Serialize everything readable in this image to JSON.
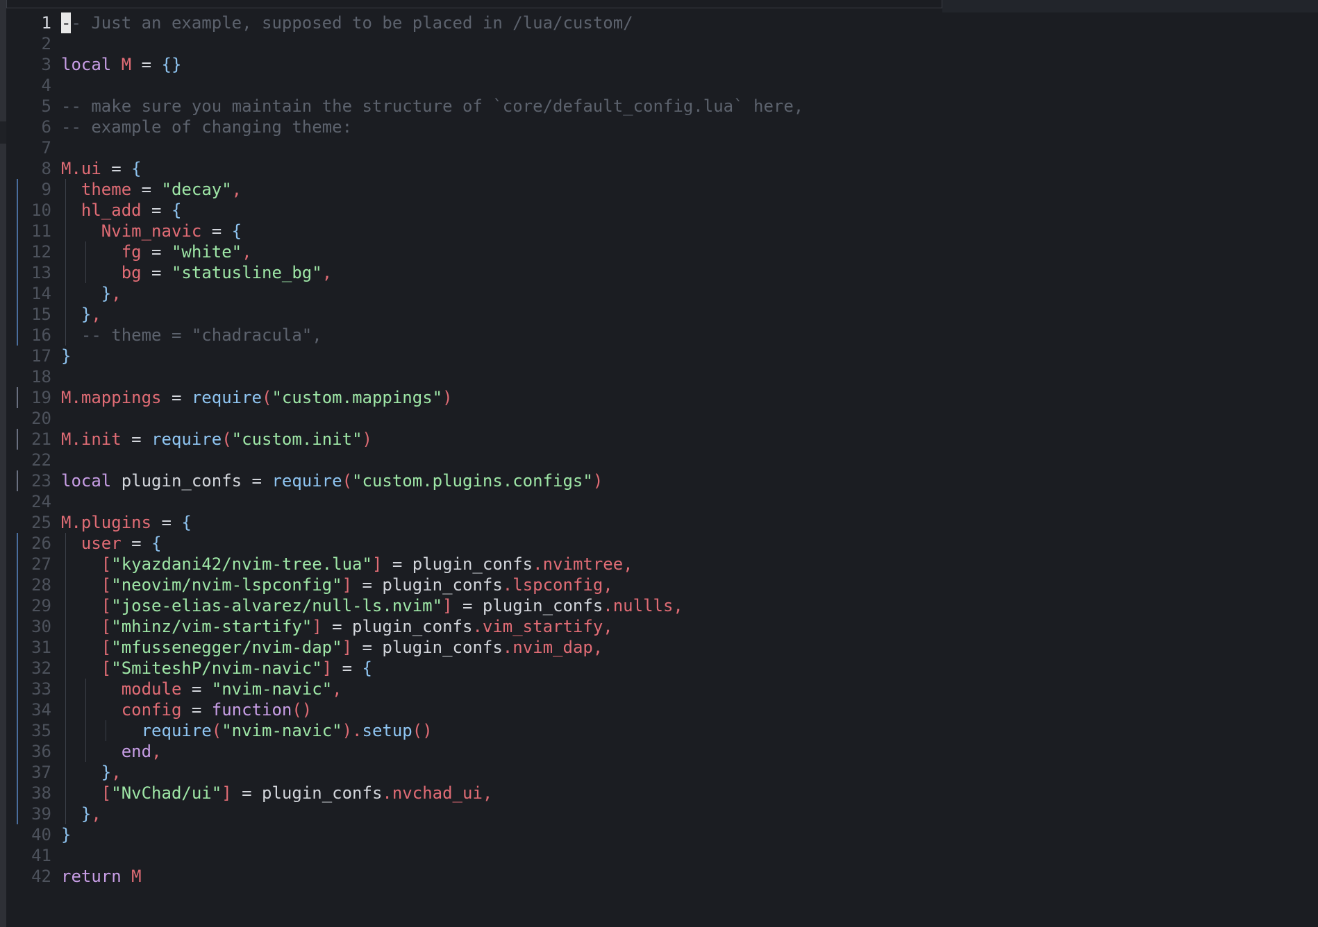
{
  "colors": {
    "background": "#1b1d22",
    "comment": "#5c626d",
    "keyword": "#c89ee6",
    "variable": "#e06c75",
    "string": "#9ee6a6",
    "function": "#8fc5f2",
    "brace": "#8fc5f2",
    "default": "#d3d6dc",
    "line_number": "#4d525c",
    "current_line_number": "#d9dce2"
  },
  "editor": {
    "current_line": 1,
    "lines": [
      {
        "num": "1",
        "tokens": [
          [
            "cursor",
            "-"
          ],
          [
            "comment",
            "- Just an example, supposed to be placed in /lua/custom/"
          ]
        ]
      },
      {
        "num": "2",
        "tokens": []
      },
      {
        "num": "3",
        "tokens": [
          [
            "keyword",
            "local"
          ],
          [
            "default",
            " "
          ],
          [
            "variable",
            "M"
          ],
          [
            "default",
            " = "
          ],
          [
            "brace",
            "{}"
          ]
        ]
      },
      {
        "num": "4",
        "tokens": []
      },
      {
        "num": "5",
        "tokens": [
          [
            "comment",
            "-- make sure you maintain the structure of `core/default_config.lua` here,"
          ]
        ]
      },
      {
        "num": "6",
        "tokens": [
          [
            "comment",
            "-- example of changing theme:"
          ]
        ]
      },
      {
        "num": "7",
        "tokens": []
      },
      {
        "num": "8",
        "tokens": [
          [
            "variable",
            "M.ui"
          ],
          [
            "default",
            " = "
          ],
          [
            "brace",
            "{"
          ]
        ]
      },
      {
        "num": "9",
        "tokens": [
          [
            "default",
            "  "
          ],
          [
            "variable",
            "theme"
          ],
          [
            "default",
            " = "
          ],
          [
            "string",
            "\"decay\""
          ],
          [
            "variable",
            ","
          ]
        ]
      },
      {
        "num": "10",
        "tokens": [
          [
            "default",
            "  "
          ],
          [
            "variable",
            "hl_add"
          ],
          [
            "default",
            " = "
          ],
          [
            "brace",
            "{"
          ]
        ]
      },
      {
        "num": "11",
        "tokens": [
          [
            "default",
            "    "
          ],
          [
            "variable",
            "Nvim_navic"
          ],
          [
            "default",
            " = "
          ],
          [
            "brace",
            "{"
          ]
        ]
      },
      {
        "num": "12",
        "tokens": [
          [
            "default",
            "      "
          ],
          [
            "variable",
            "fg"
          ],
          [
            "default",
            " = "
          ],
          [
            "string",
            "\"white\""
          ],
          [
            "variable",
            ","
          ]
        ]
      },
      {
        "num": "13",
        "tokens": [
          [
            "default",
            "      "
          ],
          [
            "variable",
            "bg"
          ],
          [
            "default",
            " = "
          ],
          [
            "string",
            "\"statusline_bg\""
          ],
          [
            "variable",
            ","
          ]
        ]
      },
      {
        "num": "14",
        "tokens": [
          [
            "default",
            "    "
          ],
          [
            "brace",
            "}"
          ],
          [
            "variable",
            ","
          ]
        ]
      },
      {
        "num": "15",
        "tokens": [
          [
            "default",
            "  "
          ],
          [
            "brace",
            "}"
          ],
          [
            "variable",
            ","
          ]
        ]
      },
      {
        "num": "16",
        "tokens": [
          [
            "default",
            "  "
          ],
          [
            "comment",
            "-- theme = \"chadracula\","
          ]
        ]
      },
      {
        "num": "17",
        "tokens": [
          [
            "brace",
            "}"
          ]
        ]
      },
      {
        "num": "18",
        "tokens": []
      },
      {
        "num": "19",
        "tokens": [
          [
            "variable",
            "M.mappings"
          ],
          [
            "default",
            " = "
          ],
          [
            "function",
            "require"
          ],
          [
            "variable",
            "("
          ],
          [
            "string",
            "\"custom.mappings\""
          ],
          [
            "variable",
            ")"
          ]
        ]
      },
      {
        "num": "20",
        "tokens": []
      },
      {
        "num": "21",
        "tokens": [
          [
            "variable",
            "M.init"
          ],
          [
            "default",
            " = "
          ],
          [
            "function",
            "require"
          ],
          [
            "variable",
            "("
          ],
          [
            "string",
            "\"custom.init\""
          ],
          [
            "variable",
            ")"
          ]
        ]
      },
      {
        "num": "22",
        "tokens": []
      },
      {
        "num": "23",
        "tokens": [
          [
            "keyword",
            "local"
          ],
          [
            "default",
            " plugin_confs = "
          ],
          [
            "function",
            "require"
          ],
          [
            "variable",
            "("
          ],
          [
            "string",
            "\"custom.plugins.configs\""
          ],
          [
            "variable",
            ")"
          ]
        ]
      },
      {
        "num": "24",
        "tokens": []
      },
      {
        "num": "25",
        "tokens": [
          [
            "variable",
            "M.plugins"
          ],
          [
            "default",
            " = "
          ],
          [
            "brace",
            "{"
          ]
        ]
      },
      {
        "num": "26",
        "tokens": [
          [
            "default",
            "  "
          ],
          [
            "variable",
            "user"
          ],
          [
            "default",
            " = "
          ],
          [
            "brace",
            "{"
          ]
        ]
      },
      {
        "num": "27",
        "tokens": [
          [
            "default",
            "    "
          ],
          [
            "variable",
            "["
          ],
          [
            "string",
            "\"kyazdani42/nvim-tree.lua\""
          ],
          [
            "variable",
            "]"
          ],
          [
            "default",
            " = plugin_confs"
          ],
          [
            "variable",
            ".nvimtree,"
          ]
        ]
      },
      {
        "num": "28",
        "tokens": [
          [
            "default",
            "    "
          ],
          [
            "variable",
            "["
          ],
          [
            "string",
            "\"neovim/nvim-lspconfig\""
          ],
          [
            "variable",
            "]"
          ],
          [
            "default",
            " = plugin_confs"
          ],
          [
            "variable",
            ".lspconfig,"
          ]
        ]
      },
      {
        "num": "29",
        "tokens": [
          [
            "default",
            "    "
          ],
          [
            "variable",
            "["
          ],
          [
            "string",
            "\"jose-elias-alvarez/null-ls.nvim\""
          ],
          [
            "variable",
            "]"
          ],
          [
            "default",
            " = plugin_confs"
          ],
          [
            "variable",
            ".nullls,"
          ]
        ]
      },
      {
        "num": "30",
        "tokens": [
          [
            "default",
            "    "
          ],
          [
            "variable",
            "["
          ],
          [
            "string",
            "\"mhinz/vim-startify\""
          ],
          [
            "variable",
            "]"
          ],
          [
            "default",
            " = plugin_confs"
          ],
          [
            "variable",
            ".vim_startify,"
          ]
        ]
      },
      {
        "num": "31",
        "tokens": [
          [
            "default",
            "    "
          ],
          [
            "variable",
            "["
          ],
          [
            "string",
            "\"mfussenegger/nvim-dap\""
          ],
          [
            "variable",
            "]"
          ],
          [
            "default",
            " = plugin_confs"
          ],
          [
            "variable",
            ".nvim_dap,"
          ]
        ]
      },
      {
        "num": "32",
        "tokens": [
          [
            "default",
            "    "
          ],
          [
            "variable",
            "["
          ],
          [
            "string",
            "\"SmiteshP/nvim-navic\""
          ],
          [
            "variable",
            "]"
          ],
          [
            "default",
            " = "
          ],
          [
            "brace",
            "{"
          ]
        ]
      },
      {
        "num": "33",
        "tokens": [
          [
            "default",
            "      "
          ],
          [
            "variable",
            "module"
          ],
          [
            "default",
            " = "
          ],
          [
            "string",
            "\"nvim-navic\""
          ],
          [
            "variable",
            ","
          ]
        ]
      },
      {
        "num": "34",
        "tokens": [
          [
            "default",
            "      "
          ],
          [
            "variable",
            "config"
          ],
          [
            "default",
            " = "
          ],
          [
            "keyword",
            "function"
          ],
          [
            "variable",
            "()"
          ]
        ]
      },
      {
        "num": "35",
        "tokens": [
          [
            "default",
            "        "
          ],
          [
            "function",
            "require"
          ],
          [
            "variable",
            "("
          ],
          [
            "string",
            "\"nvim-navic\""
          ],
          [
            "variable",
            ")."
          ],
          [
            "function",
            "setup"
          ],
          [
            "variable",
            "()"
          ]
        ]
      },
      {
        "num": "36",
        "tokens": [
          [
            "default",
            "      "
          ],
          [
            "keyword",
            "end"
          ],
          [
            "variable",
            ","
          ]
        ]
      },
      {
        "num": "37",
        "tokens": [
          [
            "default",
            "    "
          ],
          [
            "brace",
            "}"
          ],
          [
            "variable",
            ","
          ]
        ]
      },
      {
        "num": "38",
        "tokens": [
          [
            "default",
            "    "
          ],
          [
            "variable",
            "["
          ],
          [
            "string",
            "\"NvChad/ui\""
          ],
          [
            "variable",
            "]"
          ],
          [
            "default",
            " = plugin_confs"
          ],
          [
            "variable",
            ".nvchad_ui,"
          ]
        ]
      },
      {
        "num": "39",
        "tokens": [
          [
            "default",
            "  "
          ],
          [
            "brace",
            "}"
          ],
          [
            "variable",
            ","
          ]
        ]
      },
      {
        "num": "40",
        "tokens": [
          [
            "brace",
            "}"
          ]
        ]
      },
      {
        "num": "41",
        "tokens": []
      },
      {
        "num": "42",
        "tokens": [
          [
            "keyword",
            "return"
          ],
          [
            "default",
            " "
          ],
          [
            "variable",
            "M"
          ]
        ]
      }
    ]
  }
}
